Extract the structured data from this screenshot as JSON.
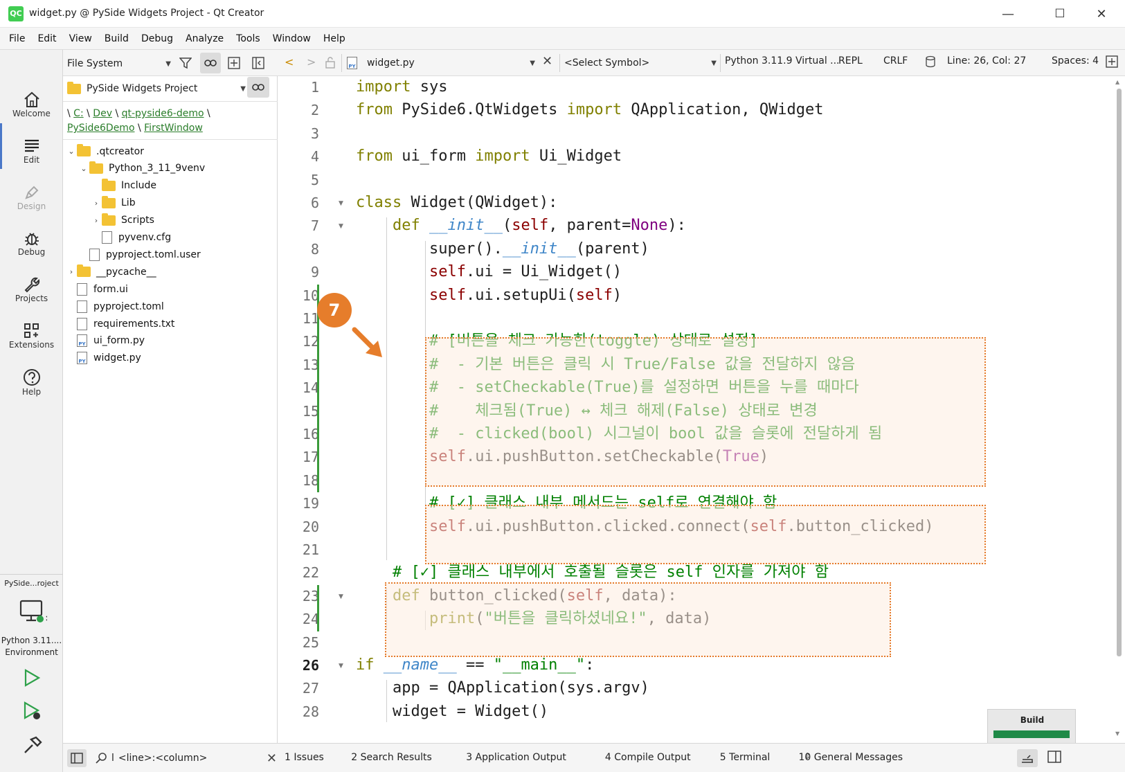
{
  "window": {
    "title": "widget.py @ PySide Widgets Project - Qt Creator",
    "app_icon": "QC",
    "minimize": "—",
    "maximize": "☐",
    "close": "✕"
  },
  "menu": [
    "File",
    "Edit",
    "View",
    "Build",
    "Debug",
    "Analyze",
    "Tools",
    "Window",
    "Help"
  ],
  "modes": [
    {
      "label": "Welcome",
      "icon": "home-icon"
    },
    {
      "label": "Edit",
      "icon": "edit-icon"
    },
    {
      "label": "Design",
      "icon": "pen-icon"
    },
    {
      "label": "Debug",
      "icon": "bug-icon"
    },
    {
      "label": "Projects",
      "icon": "wrench-icon"
    },
    {
      "label": "Extensions",
      "icon": "extensions-icon"
    },
    {
      "label": "Help",
      "icon": "help-icon"
    }
  ],
  "kit": {
    "project": "PySide...roject",
    "environment_line1": "Python 3.11....",
    "environment_line2": "Environment"
  },
  "sidebar": {
    "view_selector": "File System",
    "project_selector": "PySide Widgets Project",
    "breadcrumb": {
      "sep": "\\",
      "parts": [
        "C:",
        "Dev",
        "qt-pyside6-demo",
        "PySide6Demo",
        "FirstWindow"
      ]
    },
    "tree": [
      {
        "name": ".qtcreator",
        "type": "folder",
        "level": 0,
        "arrow": "⌄"
      },
      {
        "name": "Python_3_11_9venv",
        "type": "folder",
        "level": 1,
        "arrow": "⌄"
      },
      {
        "name": "Include",
        "type": "folder",
        "level": 2,
        "arrow": ""
      },
      {
        "name": "Lib",
        "type": "folder",
        "level": 2,
        "arrow": "›"
      },
      {
        "name": "Scripts",
        "type": "folder",
        "level": 2,
        "arrow": "›"
      },
      {
        "name": "pyvenv.cfg",
        "type": "file",
        "level": 2,
        "arrow": ""
      },
      {
        "name": "pyproject.toml.user",
        "type": "file",
        "level": 1,
        "arrow": ""
      },
      {
        "name": "__pycache__",
        "type": "folder",
        "level": 0,
        "arrow": "›"
      },
      {
        "name": "form.ui",
        "type": "file",
        "level": 0,
        "arrow": ""
      },
      {
        "name": "pyproject.toml",
        "type": "file",
        "level": 0,
        "arrow": ""
      },
      {
        "name": "requirements.txt",
        "type": "file",
        "level": 0,
        "arrow": ""
      },
      {
        "name": "ui_form.py",
        "type": "file",
        "level": 0,
        "arrow": "",
        "tag": "PY"
      },
      {
        "name": "widget.py",
        "type": "file",
        "level": 0,
        "arrow": "",
        "tag": "PY"
      }
    ]
  },
  "editor_toolbar": {
    "file_name": "widget.py",
    "symbol": "<Select Symbol>",
    "interpreter": "Python 3.11.9 Virtual ...",
    "repl": "REPL",
    "line_ending": "CRLF",
    "position": "Line: 26, Col: 27",
    "spaces": "Spaces: 4"
  },
  "editor": {
    "current_line": 26,
    "badge": "7",
    "lines": [
      "import sys",
      "from PySide6.QtWidgets import QApplication, QWidget",
      "",
      "from ui_form import Ui_Widget",
      "",
      "class Widget(QWidget):",
      "    def __init__(self, parent=None):",
      "        super().__init__(parent)",
      "        self.ui = Ui_Widget()",
      "        self.ui.setupUi(self)",
      "",
      "        # [버튼을 체크 가능한(toggle) 상태로 설정]",
      "        #  - 기본 버튼은 클릭 시 True/False 값을 전달하지 않음",
      "        #  - setCheckable(True)를 설정하면 버튼을 누를 때마다",
      "        #    체크됨(True) ↔ 체크 해제(False) 상태로 변경",
      "        #  - clicked(bool) 시그널이 bool 값을 슬롯에 전달하게 됨",
      "        self.ui.pushButton.setCheckable(True)",
      "",
      "        # [✓] 클래스 내부 메서드는 self로 연결해야 함",
      "        self.ui.pushButton.clicked.connect(self.button_clicked)",
      "",
      "    # [✓] 클래스 내부에서 호출될 슬롯은 self 인자를 가져야 함",
      "    def button_clicked(self, data):",
      "        print(\"버튼을 클릭하셨네요!\", data)",
      "",
      "if __name__ == \"__main__\":",
      "    app = QApplication(sys.argv)",
      "    widget = Widget()"
    ]
  },
  "status": {
    "locator_placeholder": "<line>:<column>",
    "locator_prefix": "l",
    "tabs": [
      "1  Issues",
      "2  Search Results",
      "3  Application Output",
      "4  Compile Output",
      "5  Terminal",
      "10  General Messages"
    ],
    "build_label": "Build",
    "build_progress": 1.0,
    "build_color": "#1f8a47"
  },
  "colors": {
    "keyword": "#808000",
    "comment": "#008000",
    "callout_border": "#e57a2a",
    "badge": "#e67d2b",
    "change_bar": "#3a9b3a"
  }
}
